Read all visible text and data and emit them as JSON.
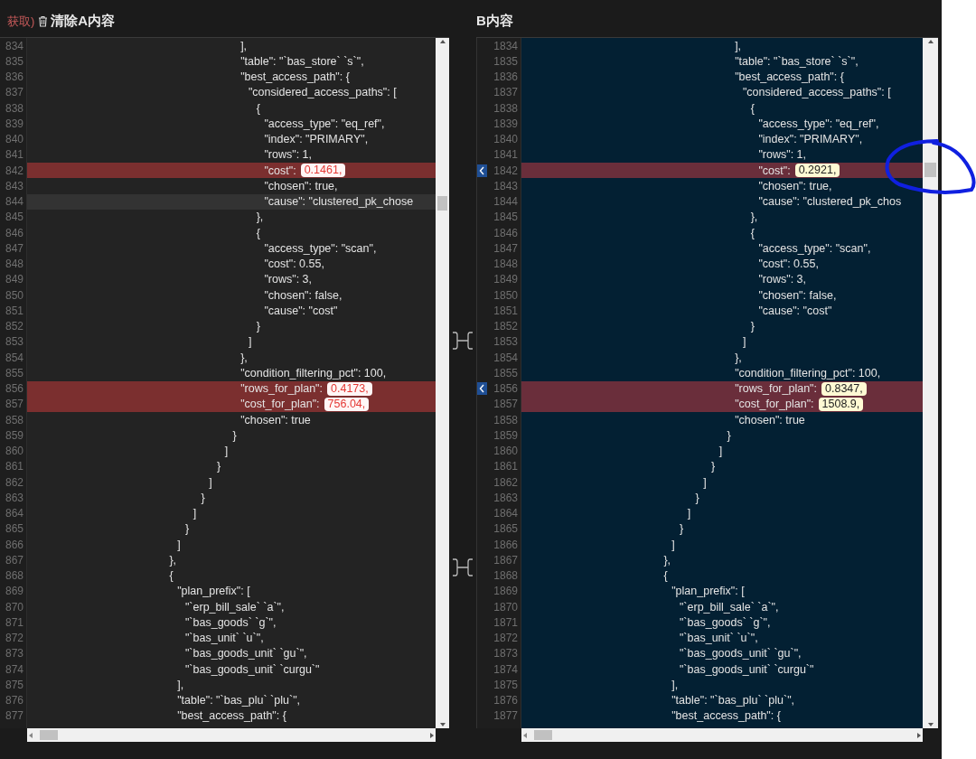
{
  "toolbar": {
    "fetch_note": "获取)",
    "clear_button": "清除A内容"
  },
  "annotation": {
    "kind": "circle"
  },
  "panes": [
    {
      "kind": "a",
      "lines": [
        {
          "number": "834",
          "text": "                                                      ],",
          "diff": false,
          "current": false
        },
        {
          "number": "835",
          "text": "                                                      \"table\": \"`bas_store` `s`\",",
          "diff": false,
          "current": false
        },
        {
          "number": "836",
          "text": "                                                      \"best_access_path\": {",
          "diff": false,
          "current": false
        },
        {
          "number": "837",
          "text": "                                                        \"considered_access_paths\": [",
          "diff": false,
          "current": false
        },
        {
          "number": "838",
          "text": "                                                          {",
          "diff": false,
          "current": false
        },
        {
          "number": "839",
          "text": "                                                            \"access_type\": \"eq_ref\",",
          "diff": false,
          "current": false
        },
        {
          "number": "840",
          "text": "                                                            \"index\": \"PRIMARY\",",
          "diff": false,
          "current": false
        },
        {
          "number": "841",
          "text": "                                                            \"rows\": 1,",
          "diff": false,
          "current": false
        },
        {
          "number": "842",
          "text": "                                                            \"cost\":",
          "value": "0.1461,",
          "diff": true,
          "current": false
        },
        {
          "number": "843",
          "text": "                                                            \"chosen\": true,",
          "diff": false,
          "current": false
        },
        {
          "number": "844",
          "text": "                                                            \"cause\": \"clustered_pk_chose",
          "diff": false,
          "current": true
        },
        {
          "number": "845",
          "text": "                                                          },",
          "diff": false,
          "current": false
        },
        {
          "number": "846",
          "text": "                                                          {",
          "diff": false,
          "current": false
        },
        {
          "number": "847",
          "text": "                                                            \"access_type\": \"scan\",",
          "diff": false,
          "current": false
        },
        {
          "number": "848",
          "text": "                                                            \"cost\": 0.55,",
          "diff": false,
          "current": false
        },
        {
          "number": "849",
          "text": "                                                            \"rows\": 3,",
          "diff": false,
          "current": false
        },
        {
          "number": "850",
          "text": "                                                            \"chosen\": false,",
          "diff": false,
          "current": false
        },
        {
          "number": "851",
          "text": "                                                            \"cause\": \"cost\"",
          "diff": false,
          "current": false
        },
        {
          "number": "852",
          "text": "                                                          }",
          "diff": false,
          "current": false
        },
        {
          "number": "853",
          "text": "                                                        ]",
          "diff": false,
          "current": false
        },
        {
          "number": "854",
          "text": "                                                      },",
          "diff": false,
          "current": false
        },
        {
          "number": "855",
          "text": "                                                      \"condition_filtering_pct\": 100,",
          "diff": false,
          "current": false
        },
        {
          "number": "856",
          "text": "                                                      \"rows_for_plan\":",
          "value": "0.4173,",
          "diff": true,
          "current": false
        },
        {
          "number": "857",
          "text": "                                                      \"cost_for_plan\":",
          "value": "756.04,",
          "diff": true,
          "current": false
        },
        {
          "number": "858",
          "text": "                                                      \"chosen\": true",
          "diff": false,
          "current": false
        },
        {
          "number": "859",
          "text": "                                                    }",
          "diff": false,
          "current": false
        },
        {
          "number": "860",
          "text": "                                                  ]",
          "diff": false,
          "current": false
        },
        {
          "number": "861",
          "text": "                                                }",
          "diff": false,
          "current": false
        },
        {
          "number": "862",
          "text": "                                              ]",
          "diff": false,
          "current": false
        },
        {
          "number": "863",
          "text": "                                            }",
          "diff": false,
          "current": false
        },
        {
          "number": "864",
          "text": "                                          ]",
          "diff": false,
          "current": false
        },
        {
          "number": "865",
          "text": "                                        }",
          "diff": false,
          "current": false
        },
        {
          "number": "866",
          "text": "                                      ]",
          "diff": false,
          "current": false
        },
        {
          "number": "867",
          "text": "                                    },",
          "diff": false,
          "current": false
        },
        {
          "number": "868",
          "text": "                                    {",
          "diff": false,
          "current": false
        },
        {
          "number": "869",
          "text": "                                      \"plan_prefix\": [",
          "diff": false,
          "current": false
        },
        {
          "number": "870",
          "text": "                                        \"`erp_bill_sale` `a`\",",
          "diff": false,
          "current": false
        },
        {
          "number": "871",
          "text": "                                        \"`bas_goods` `g`\",",
          "diff": false,
          "current": false
        },
        {
          "number": "872",
          "text": "                                        \"`bas_unit` `u`\",",
          "diff": false,
          "current": false
        },
        {
          "number": "873",
          "text": "                                        \"`bas_goods_unit` `gu`\",",
          "diff": false,
          "current": false
        },
        {
          "number": "874",
          "text": "                                        \"`bas_goods_unit` `curgu`\"",
          "diff": false,
          "current": false
        },
        {
          "number": "875",
          "text": "                                      ],",
          "diff": false,
          "current": false
        },
        {
          "number": "876",
          "text": "                                      \"table\": \"`bas_plu` `plu`\",",
          "diff": false,
          "current": false
        },
        {
          "number": "877",
          "text": "                                      \"best_access_path\": {",
          "diff": false,
          "current": false
        }
      ]
    },
    {
      "kind": "b",
      "title": "B内容",
      "lines": [
        {
          "number": "1834",
          "text": "                                                      ],",
          "diff": false,
          "current": false,
          "arrow": false
        },
        {
          "number": "1835",
          "text": "                                                      \"table\": \"`bas_store` `s`\",",
          "diff": false,
          "current": false,
          "arrow": false
        },
        {
          "number": "1836",
          "text": "                                                      \"best_access_path\": {",
          "diff": false,
          "current": false,
          "arrow": false
        },
        {
          "number": "1837",
          "text": "                                                        \"considered_access_paths\": [",
          "diff": false,
          "current": false,
          "arrow": false
        },
        {
          "number": "1838",
          "text": "                                                          {",
          "diff": false,
          "current": false,
          "arrow": false
        },
        {
          "number": "1839",
          "text": "                                                            \"access_type\": \"eq_ref\",",
          "diff": false,
          "current": false,
          "arrow": false
        },
        {
          "number": "1840",
          "text": "                                                            \"index\": \"PRIMARY\",",
          "diff": false,
          "current": false,
          "arrow": false
        },
        {
          "number": "1841",
          "text": "                                                            \"rows\": 1,",
          "diff": false,
          "current": false,
          "arrow": false
        },
        {
          "number": "1842",
          "text": "                                                            \"cost\":",
          "value": "0.2921,",
          "diff": true,
          "current": false,
          "arrow": true
        },
        {
          "number": "1843",
          "text": "                                                            \"chosen\": true,",
          "diff": false,
          "current": false,
          "arrow": false
        },
        {
          "number": "1844",
          "text": "                                                            \"cause\": \"clustered_pk_chos",
          "diff": false,
          "current": false,
          "arrow": false
        },
        {
          "number": "1845",
          "text": "                                                          },",
          "diff": false,
          "current": false,
          "arrow": false
        },
        {
          "number": "1846",
          "text": "                                                          {",
          "diff": false,
          "current": false,
          "arrow": false
        },
        {
          "number": "1847",
          "text": "                                                            \"access_type\": \"scan\",",
          "diff": false,
          "current": false,
          "arrow": false
        },
        {
          "number": "1848",
          "text": "                                                            \"cost\": 0.55,",
          "diff": false,
          "current": false,
          "arrow": false
        },
        {
          "number": "1849",
          "text": "                                                            \"rows\": 3,",
          "diff": false,
          "current": false,
          "arrow": false
        },
        {
          "number": "1850",
          "text": "                                                            \"chosen\": false,",
          "diff": false,
          "current": false,
          "arrow": false
        },
        {
          "number": "1851",
          "text": "                                                            \"cause\": \"cost\"",
          "diff": false,
          "current": false,
          "arrow": false
        },
        {
          "number": "1852",
          "text": "                                                          }",
          "diff": false,
          "current": false,
          "arrow": false
        },
        {
          "number": "1853",
          "text": "                                                        ]",
          "diff": false,
          "current": false,
          "arrow": false
        },
        {
          "number": "1854",
          "text": "                                                      },",
          "diff": false,
          "current": false,
          "arrow": false
        },
        {
          "number": "1855",
          "text": "                                                      \"condition_filtering_pct\": 100,",
          "diff": false,
          "current": false,
          "arrow": false
        },
        {
          "number": "1856",
          "text": "                                                      \"rows_for_plan\":",
          "value": "0.8347,",
          "diff": true,
          "current": false,
          "arrow": true
        },
        {
          "number": "1857",
          "text": "                                                      \"cost_for_plan\":",
          "value": "1508.9,",
          "diff": true,
          "current": false,
          "arrow": false
        },
        {
          "number": "1858",
          "text": "                                                      \"chosen\": true",
          "diff": false,
          "current": false,
          "arrow": false
        },
        {
          "number": "1859",
          "text": "                                                    }",
          "diff": false,
          "current": false,
          "arrow": false
        },
        {
          "number": "1860",
          "text": "                                                  ]",
          "diff": false,
          "current": false,
          "arrow": false
        },
        {
          "number": "1861",
          "text": "                                                }",
          "diff": false,
          "current": false,
          "arrow": false
        },
        {
          "number": "1862",
          "text": "                                              ]",
          "diff": false,
          "current": false,
          "arrow": false
        },
        {
          "number": "1863",
          "text": "                                            }",
          "diff": false,
          "current": false,
          "arrow": false
        },
        {
          "number": "1864",
          "text": "                                          ]",
          "diff": false,
          "current": false,
          "arrow": false
        },
        {
          "number": "1865",
          "text": "                                        }",
          "diff": false,
          "current": false,
          "arrow": false
        },
        {
          "number": "1866",
          "text": "                                      ]",
          "diff": false,
          "current": false,
          "arrow": false
        },
        {
          "number": "1867",
          "text": "                                    },",
          "diff": false,
          "current": false,
          "arrow": false
        },
        {
          "number": "1868",
          "text": "                                    {",
          "diff": false,
          "current": false,
          "arrow": false
        },
        {
          "number": "1869",
          "text": "                                      \"plan_prefix\": [",
          "diff": false,
          "current": false,
          "arrow": false
        },
        {
          "number": "1870",
          "text": "                                        \"`erp_bill_sale` `a`\",",
          "diff": false,
          "current": false,
          "arrow": false
        },
        {
          "number": "1871",
          "text": "                                        \"`bas_goods` `g`\",",
          "diff": false,
          "current": false,
          "arrow": false
        },
        {
          "number": "1872",
          "text": "                                        \"`bas_unit` `u`\",",
          "diff": false,
          "current": false,
          "arrow": false
        },
        {
          "number": "1873",
          "text": "                                        \"`bas_goods_unit` `gu`\",",
          "diff": false,
          "current": false,
          "arrow": false
        },
        {
          "number": "1874",
          "text": "                                        \"`bas_goods_unit` `curgu`\"",
          "diff": false,
          "current": false,
          "arrow": false
        },
        {
          "number": "1875",
          "text": "                                      ],",
          "diff": false,
          "current": false,
          "arrow": false
        },
        {
          "number": "1876",
          "text": "                                      \"table\": \"`bas_plu` `plu`\",",
          "diff": false,
          "current": false,
          "arrow": false
        },
        {
          "number": "1877",
          "text": "                                      \"best_access_path\": {",
          "diff": false,
          "current": false,
          "arrow": false
        }
      ]
    }
  ]
}
